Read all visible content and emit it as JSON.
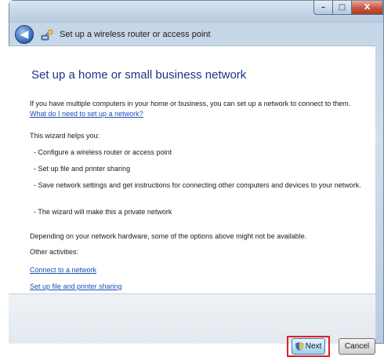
{
  "titlebar": {
    "minimize_glyph": "–",
    "maximize_glyph": "□",
    "close_glyph": "X"
  },
  "nav": {
    "back_glyph": "◀",
    "title": "Set up a wireless router or access point",
    "icon": "wizard-network-icon"
  },
  "main": {
    "heading": "Set up a home or small business network",
    "intro": "If you have multiple computers in your home or business, you can set up a network to connect to them.",
    "intro_link": "What do I need to set up a network?",
    "helps_label": "This wizard helps you:",
    "bullets": [
      "- Configure a wireless router or access point",
      "- Set up file and printer sharing",
      "- Save network settings and get instructions for connecting other computers and devices to your network.",
      "- The wizard will make this a private network"
    ],
    "hardware_note": "Depending on your network hardware, some of the options above might not be available.",
    "other_label": "Other activities:",
    "activity_links": [
      "Connect to a network",
      "Set up file and printer sharing"
    ]
  },
  "buttons": {
    "next_label": "Next",
    "cancel_label": "Cancel"
  },
  "colors": {
    "heading": "#1e3287",
    "link": "#1a4fb8",
    "highlight": "#dd2222"
  }
}
